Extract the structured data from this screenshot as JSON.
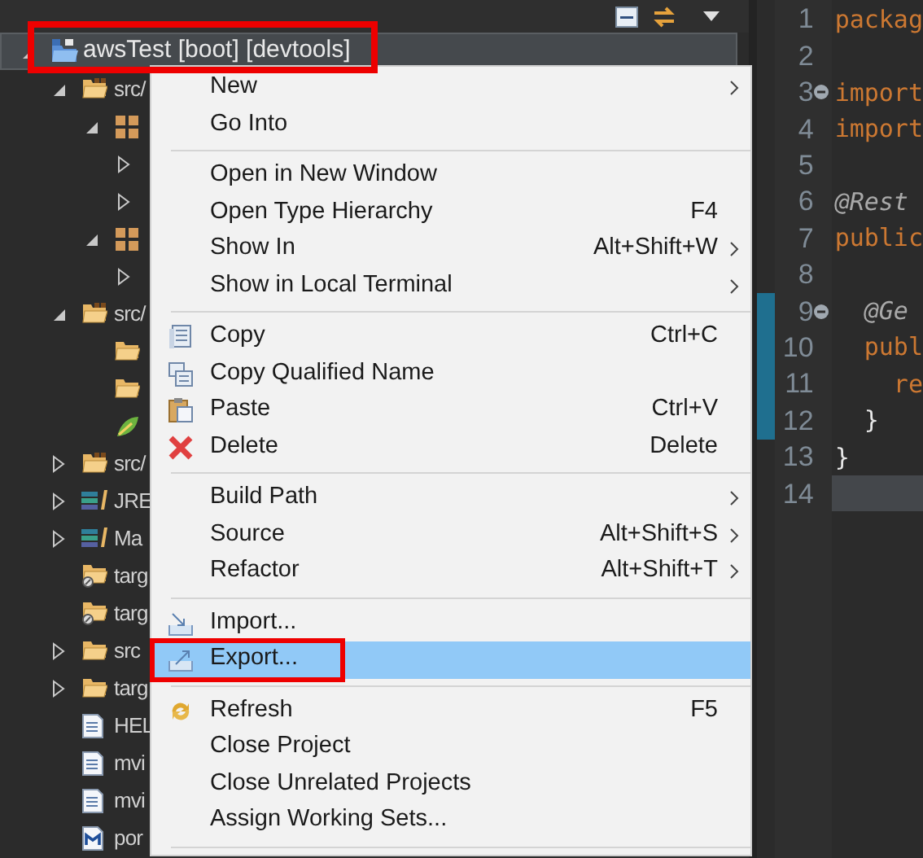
{
  "project": {
    "label": "awsTest [boot] [devtools]",
    "kind": "project",
    "expanded": true,
    "selected": true,
    "highlighted": true,
    "children": [
      {
        "label": "src/",
        "kind": "source-folder",
        "expanded": true,
        "children": [
          {
            "kind": "package",
            "expanded": true,
            "children": [
              {
                "expanded": false
              },
              {
                "expanded": false
              }
            ]
          },
          {
            "kind": "package",
            "expanded": true,
            "children": [
              {
                "expanded": false
              }
            ]
          }
        ]
      },
      {
        "label": "src/",
        "kind": "source-folder",
        "expanded": true,
        "children": [
          {
            "kind": "folder"
          },
          {
            "kind": "folder"
          },
          {
            "kind": "spring-file"
          }
        ]
      },
      {
        "label": "src/",
        "kind": "source-folder",
        "expanded": false
      },
      {
        "label": "JRE",
        "kind": "library",
        "expanded": false
      },
      {
        "label": "Ma",
        "kind": "library",
        "expanded": false
      },
      {
        "label": "targ",
        "kind": "output-folder"
      },
      {
        "label": "targ",
        "kind": "output-folder"
      },
      {
        "label": "src",
        "kind": "folder",
        "expanded": false
      },
      {
        "label": "targ",
        "kind": "folder",
        "expanded": false
      },
      {
        "label": "HEL",
        "kind": "file"
      },
      {
        "label": "mvi",
        "kind": "file"
      },
      {
        "label": "mvi",
        "kind": "file"
      },
      {
        "label": "por",
        "kind": "maven-file"
      }
    ]
  },
  "context_menu": [
    {
      "kind": "plain",
      "label": "New",
      "submenu": true,
      "selected": false,
      "highlighted": false
    },
    {
      "kind": "plain",
      "label": "Go Into",
      "submenu": false,
      "selected": false,
      "highlighted": false
    },
    {
      "kind": "separator"
    },
    {
      "kind": "plain",
      "label": "Open in New Window",
      "submenu": false,
      "selected": false,
      "highlighted": false
    },
    {
      "kind": "plain",
      "label": "Open Type Hierarchy",
      "shortcut": "F4",
      "submenu": false,
      "selected": false,
      "highlighted": false
    },
    {
      "kind": "plain",
      "label": "Show In",
      "shortcut": "Alt+Shift+W",
      "submenu": true,
      "selected": false,
      "highlighted": false
    },
    {
      "kind": "plain",
      "label": "Show in Local Terminal",
      "submenu": true,
      "selected": false,
      "highlighted": false
    },
    {
      "kind": "separator"
    },
    {
      "kind": "copy",
      "label": "Copy",
      "shortcut": "Ctrl+C",
      "submenu": false,
      "selected": false,
      "highlighted": false
    },
    {
      "kind": "copy-qualified",
      "label": "Copy Qualified Name",
      "submenu": false,
      "selected": false,
      "highlighted": false
    },
    {
      "kind": "paste",
      "label": "Paste",
      "shortcut": "Ctrl+V",
      "submenu": false,
      "selected": false,
      "highlighted": false
    },
    {
      "kind": "delete",
      "label": "Delete",
      "shortcut": "Delete",
      "submenu": false,
      "selected": false,
      "highlighted": false
    },
    {
      "kind": "separator"
    },
    {
      "kind": "plain",
      "label": "Build Path",
      "submenu": true,
      "selected": false,
      "highlighted": false
    },
    {
      "kind": "plain",
      "label": "Source",
      "shortcut": "Alt+Shift+S",
      "submenu": true,
      "selected": false,
      "highlighted": false
    },
    {
      "kind": "plain",
      "label": "Refactor",
      "shortcut": "Alt+Shift+T",
      "submenu": true,
      "selected": false,
      "highlighted": false
    },
    {
      "kind": "separator"
    },
    {
      "kind": "import",
      "label": "Import...",
      "submenu": false,
      "selected": false,
      "highlighted": false
    },
    {
      "kind": "export",
      "label": "Export...",
      "submenu": false,
      "selected": true,
      "highlighted": true
    },
    {
      "kind": "separator"
    },
    {
      "kind": "refresh",
      "label": "Refresh",
      "shortcut": "F5",
      "submenu": false,
      "selected": false,
      "highlighted": false
    },
    {
      "kind": "plain",
      "label": "Close Project",
      "submenu": false,
      "selected": false,
      "highlighted": false
    },
    {
      "kind": "plain",
      "label": "Close Unrelated Projects",
      "submenu": false,
      "selected": false,
      "highlighted": false
    },
    {
      "kind": "plain",
      "label": "Assign Working Sets...",
      "submenu": false,
      "selected": false,
      "highlighted": false
    },
    {
      "kind": "separator"
    }
  ],
  "editor": {
    "lines": [
      {
        "number": "1",
        "text": "packag",
        "kind": "keyword",
        "folding": false,
        "changed": false,
        "current": false
      },
      {
        "number": "2",
        "folding": false,
        "changed": false,
        "current": false
      },
      {
        "number": "3",
        "text": "import",
        "kind": "keyword",
        "folding": true,
        "changed": false,
        "current": false
      },
      {
        "number": "4",
        "text": "import",
        "kind": "keyword",
        "folding": false,
        "changed": false,
        "current": false
      },
      {
        "number": "5",
        "folding": false,
        "changed": false,
        "current": false
      },
      {
        "number": "6",
        "text": "@Rest",
        "kind": "annotation",
        "folding": false,
        "changed": false,
        "current": false
      },
      {
        "number": "7",
        "text": "public",
        "kind": "keyword",
        "folding": false,
        "changed": false,
        "current": false
      },
      {
        "number": "8",
        "folding": false,
        "changed": false,
        "current": false
      },
      {
        "number": "9",
        "text": "  @Ge",
        "kind": "annotation",
        "folding": true,
        "changed": true,
        "current": false
      },
      {
        "number": "10",
        "text": "  publ",
        "kind": "keyword",
        "folding": false,
        "changed": true,
        "current": false
      },
      {
        "number": "11",
        "text": "    re",
        "kind": "keyword",
        "folding": false,
        "changed": true,
        "current": false
      },
      {
        "number": "12",
        "text": "  }",
        "kind": "plain",
        "folding": false,
        "changed": true,
        "current": false
      },
      {
        "number": "13",
        "text": "}",
        "kind": "plain",
        "folding": false,
        "changed": false,
        "current": false
      },
      {
        "number": "14",
        "folding": false,
        "changed": false,
        "current": true
      }
    ]
  }
}
